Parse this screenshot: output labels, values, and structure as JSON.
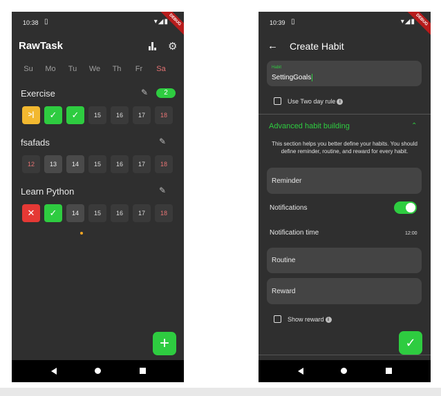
{
  "status": {
    "time_left": "10:38",
    "time_right": "10:39",
    "sim_icon": "sim-card-icon",
    "icons": "▾◢▮"
  },
  "debug_label": "DEBUG",
  "habit_list": {
    "title": "RawTask",
    "weekdays": [
      "Su",
      "Mo",
      "Tu",
      "We",
      "Th",
      "Fr",
      "Sa"
    ],
    "habits": [
      {
        "name": "Exercise",
        "streak": "2",
        "cells": [
          {
            "text": ">|",
            "state": "skip"
          },
          {
            "text": "✓",
            "state": "done"
          },
          {
            "text": "✓",
            "state": "done"
          },
          {
            "text": "15",
            "state": "future"
          },
          {
            "text": "16",
            "state": "future"
          },
          {
            "text": "17",
            "state": "future"
          },
          {
            "text": "18",
            "state": "future-sat"
          }
        ]
      },
      {
        "name": "fsafads",
        "cells": [
          {
            "text": "12",
            "state": "past-dim"
          },
          {
            "text": "13",
            "state": "past"
          },
          {
            "text": "14",
            "state": "today"
          },
          {
            "text": "15",
            "state": "future"
          },
          {
            "text": "16",
            "state": "future"
          },
          {
            "text": "17",
            "state": "future"
          },
          {
            "text": "18",
            "state": "future-sat"
          }
        ]
      },
      {
        "name": "Learn Python",
        "cells": [
          {
            "text": "✕",
            "state": "fail"
          },
          {
            "text": "✓",
            "state": "done"
          },
          {
            "text": "14",
            "state": "today"
          },
          {
            "text": "15",
            "state": "future"
          },
          {
            "text": "16",
            "state": "future"
          },
          {
            "text": "17",
            "state": "future"
          },
          {
            "text": "18",
            "state": "future-sat"
          }
        ]
      }
    ],
    "fab_label": "+"
  },
  "create_habit": {
    "title": "Create Habit",
    "habit_field_label": "Habit",
    "habit_field_value": "SettingGoals",
    "two_day_rule_label": "Use Two day rule",
    "advanced_title": "Advanced habit building",
    "advanced_desc": "This section helps you better define your habits. You should define reminder, routine, and reward for every habit.",
    "reminder_label": "Reminder",
    "notifications_label": "Notifications",
    "notification_time_label": "Notification time",
    "notification_time_value": "12:00",
    "routine_label": "Routine",
    "reward_label": "Reward",
    "show_reward_label": "Show reward",
    "fab_label": "✓"
  },
  "colors": {
    "accent": "#2ecc40",
    "background": "#2f2f2f",
    "skip": "#f2b830",
    "fail": "#e53935",
    "weekend": "#e57373"
  }
}
